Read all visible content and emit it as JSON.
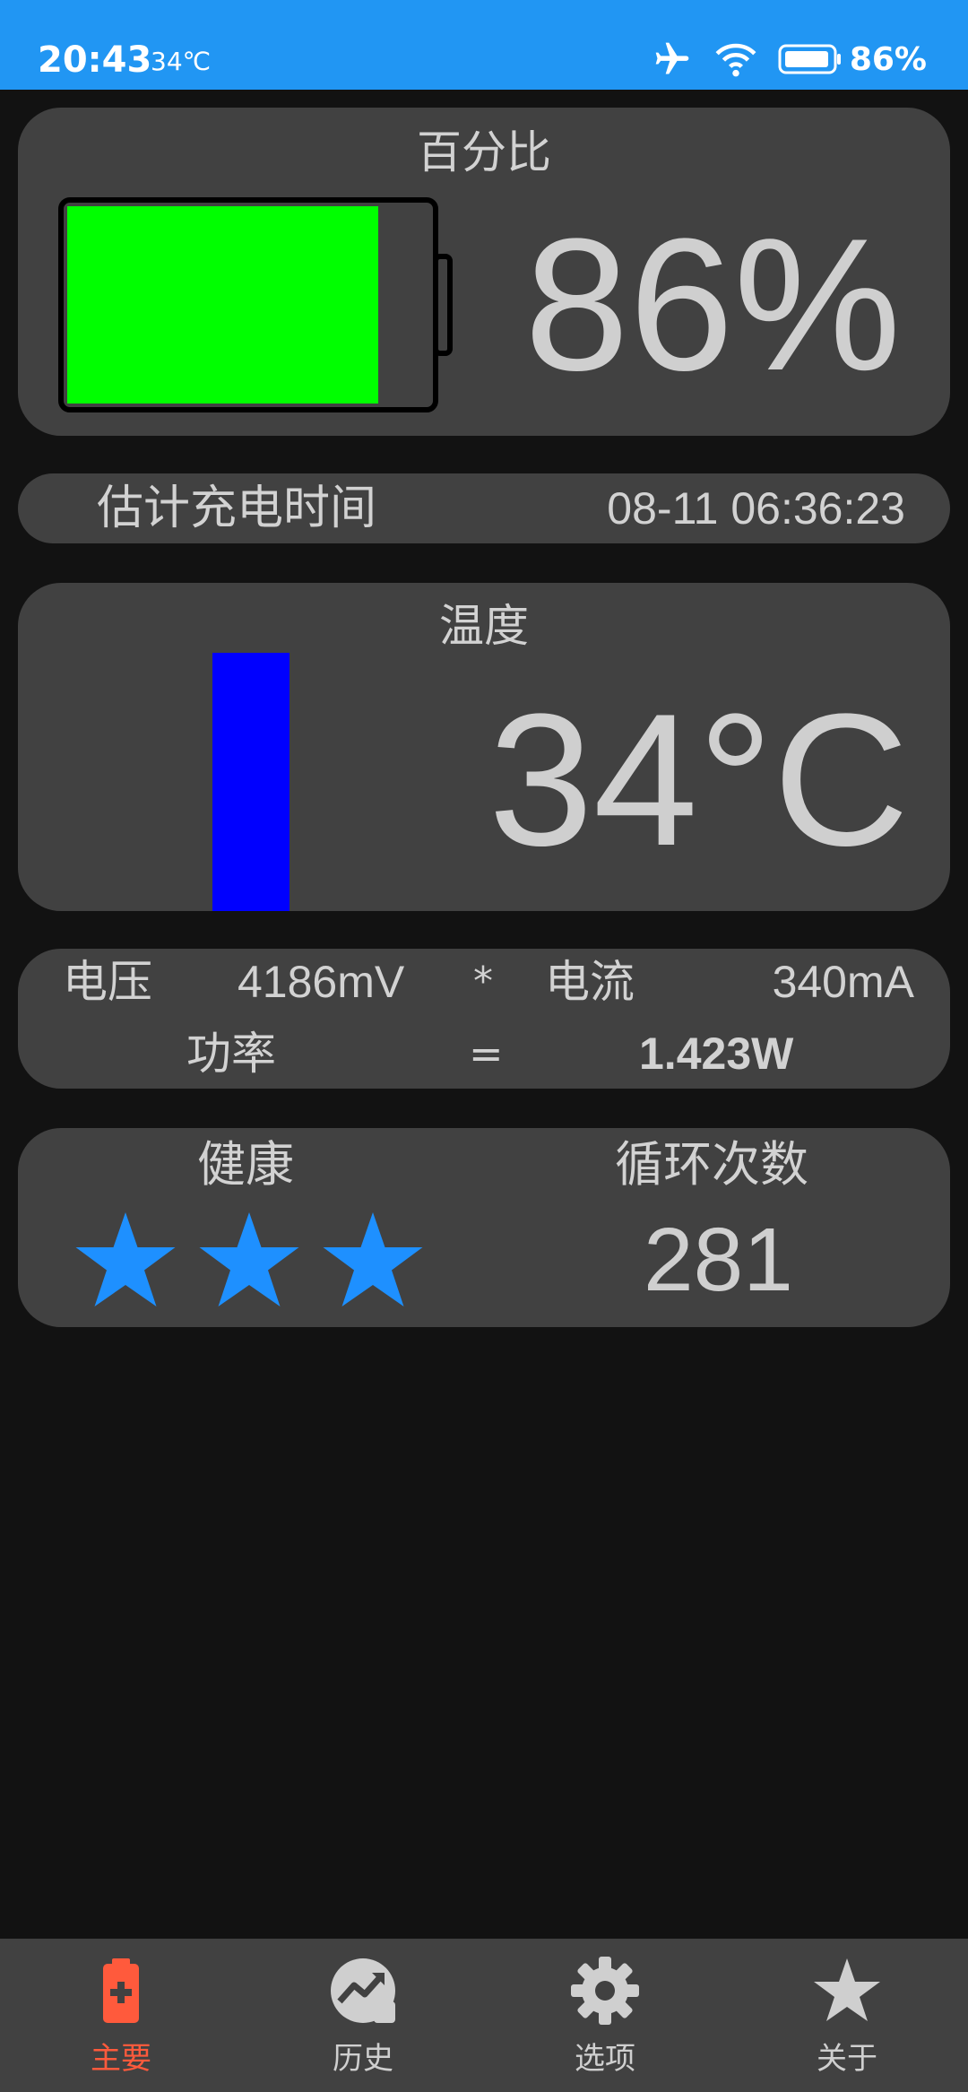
{
  "status_bar": {
    "time": "20:43",
    "temperature": "34℃",
    "battery_percent": "86%"
  },
  "percent_card": {
    "title": "百分比",
    "value": "86%",
    "battery_level": 0.86,
    "fill_color": "#00FF00"
  },
  "estimate_card": {
    "label": "估计充电时间",
    "value": "08-11 06:36:23"
  },
  "temperature_card": {
    "title": "温度",
    "value": "34°C",
    "bar_color": "#0000FF"
  },
  "power_card": {
    "voltage_label": "电压",
    "voltage_value": "4186mV",
    "multiply": "*",
    "current_label": "电流",
    "current_value": "340mA",
    "power_label": "功率",
    "equals": "=",
    "power_value": "1.423W"
  },
  "health_card": {
    "health_label": "健康",
    "stars": 3,
    "star_color": "#1E90FF",
    "cycles_label": "循环次数",
    "cycles_value": "281"
  },
  "bottom_nav": {
    "items": [
      {
        "label": "主要",
        "icon": "battery-plus-icon",
        "active": true
      },
      {
        "label": "历史",
        "icon": "trending-chart-icon",
        "active": false
      },
      {
        "label": "选项",
        "icon": "gear-icon",
        "active": false
      },
      {
        "label": "关于",
        "icon": "star-icon",
        "active": false
      }
    ],
    "active_color": "#FF5A3C",
    "inactive_color": "#CFCFCF"
  }
}
